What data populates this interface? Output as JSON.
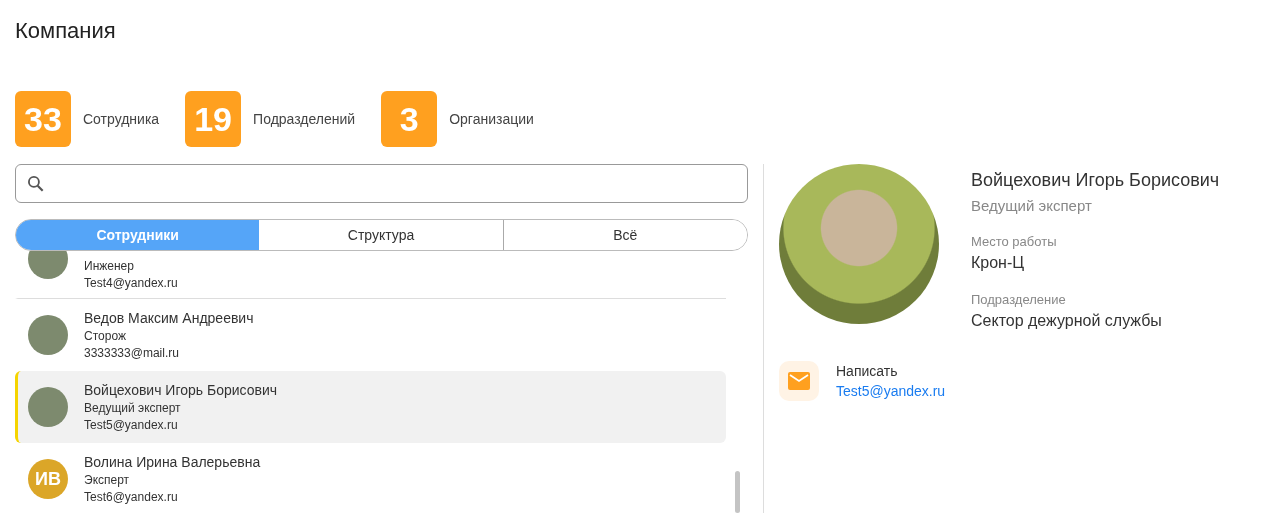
{
  "title": "Компания",
  "stats": [
    {
      "value": "33",
      "label": "Сотрудника"
    },
    {
      "value": "19",
      "label": "Подразделений"
    },
    {
      "value": "3",
      "label": "Организации"
    }
  ],
  "tabs": [
    {
      "label": "Сотрудники",
      "selected": true
    },
    {
      "label": "Структура",
      "selected": false
    },
    {
      "label": "Всё",
      "selected": false
    }
  ],
  "employees": [
    {
      "kind": "photo",
      "role": "Инженер",
      "email": "Test4@yandex.ru",
      "selected": false,
      "partial": true
    },
    {
      "kind": "photo",
      "name": "Ведов Максим Андреевич",
      "role": "Сторож",
      "email": "3333333@mail.ru",
      "selected": false
    },
    {
      "kind": "photo",
      "name": "Войцехович Игорь Борисович",
      "role": "Ведущий эксперт",
      "email": "Test5@yandex.ru",
      "selected": true
    },
    {
      "kind": "initials",
      "initials": "ИВ",
      "color": "#dba628",
      "name": "Волина Ирина Валерьевна",
      "role": "Эксперт",
      "email": "Test6@yandex.ru",
      "selected": false
    }
  ],
  "profile": {
    "name": "Войцехович Игорь Борисович",
    "position": "Ведущий эксперт",
    "fields": [
      {
        "label": "Место работы",
        "value": "Крон-Ц"
      },
      {
        "label": "Подразделение",
        "value": "Сектор дежурной службы"
      }
    ],
    "contact": {
      "label": "Написать",
      "email": "Test5@yandex.ru"
    }
  }
}
